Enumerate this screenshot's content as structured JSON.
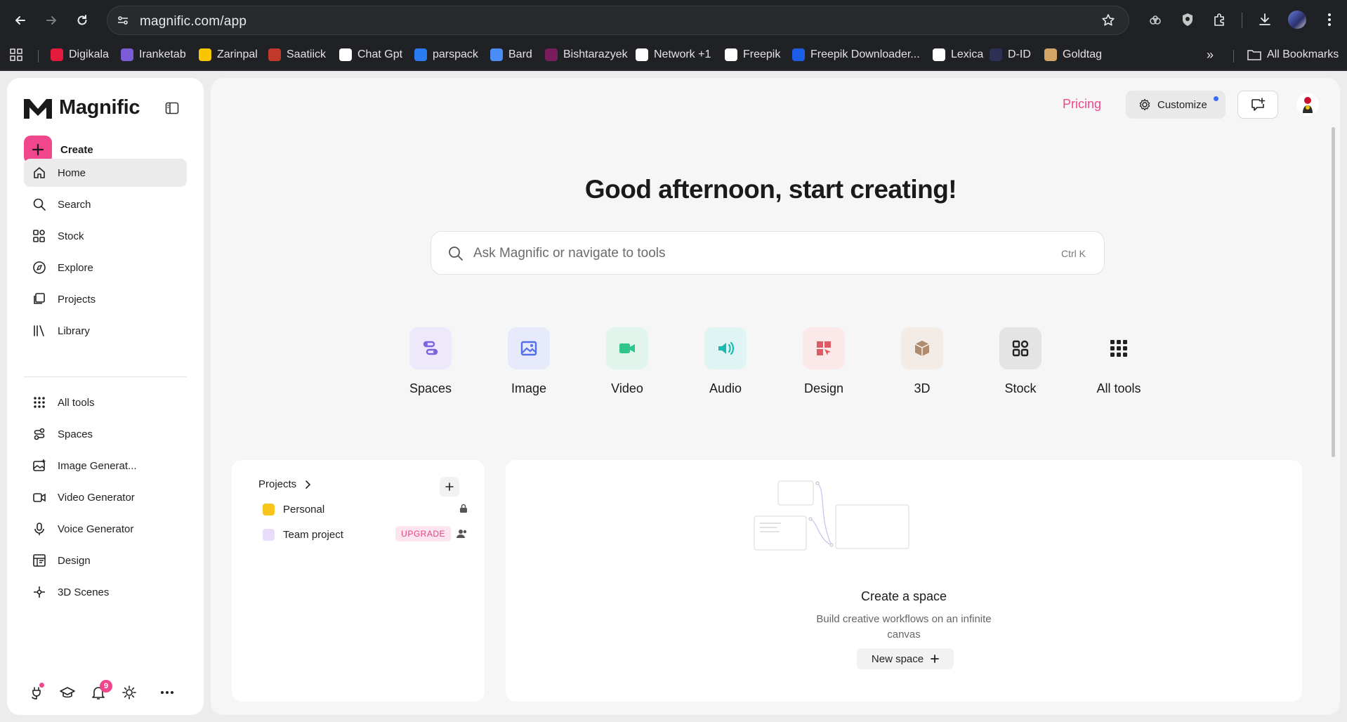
{
  "browser": {
    "url": "magnific.com/app",
    "bookmarks": [
      {
        "label": "Digikala",
        "color": "#e51b3e"
      },
      {
        "label": "Iranketab",
        "color": "#7b5cd6"
      },
      {
        "label": "Zarinpal",
        "color": "#f7c600"
      },
      {
        "label": "Saatiick",
        "color": "#c0392b"
      },
      {
        "label": "Chat Gpt",
        "color": "#ffffff"
      },
      {
        "label": "parspack",
        "color": "#2b7bf2"
      },
      {
        "label": "Bard",
        "color": "#4b8cf7"
      },
      {
        "label": "Bishtarazyek",
        "color": "#7a1d5c"
      },
      {
        "label": "Network +1",
        "color": "#ffffff"
      },
      {
        "label": "Freepik",
        "color": "#ffffff"
      },
      {
        "label": "Freepik Downloader...",
        "color": "#1c5ee8"
      },
      {
        "label": "Lexica",
        "color": "#ffffff"
      },
      {
        "label": "D-ID",
        "color": "#2d2f55"
      },
      {
        "label": "Goldtag",
        "color": "#d3a463"
      }
    ],
    "all_bookmarks": "All Bookmarks"
  },
  "sidebar": {
    "logo": "Magnific",
    "create": "Create",
    "primary": [
      {
        "label": "Home",
        "icon": "home-icon"
      },
      {
        "label": "Search",
        "icon": "search-icon"
      },
      {
        "label": "Stock",
        "icon": "stock-icon"
      },
      {
        "label": "Explore",
        "icon": "explore-icon"
      },
      {
        "label": "Projects",
        "icon": "projects-icon"
      },
      {
        "label": "Library",
        "icon": "library-icon"
      }
    ],
    "secondary": [
      {
        "label": "All tools",
        "icon": "grid-icon"
      },
      {
        "label": "Spaces",
        "icon": "spaces-icon"
      },
      {
        "label": "Image Generat...",
        "icon": "image-icon"
      },
      {
        "label": "Video Generator",
        "icon": "video-icon"
      },
      {
        "label": "Voice Generator",
        "icon": "mic-icon"
      },
      {
        "label": "Design",
        "icon": "design-icon"
      },
      {
        "label": "3D Scenes",
        "icon": "3d-icon"
      }
    ],
    "notification_count": "9"
  },
  "header": {
    "pricing": "Pricing",
    "customize": "Customize"
  },
  "main": {
    "greeting": "Good afternoon, start creating!",
    "search_placeholder": "Ask Magnific or navigate to tools",
    "search_shortcut": "Ctrl K",
    "tools": [
      {
        "label": "Spaces",
        "bg": "#ede9fb",
        "fg": "#7a63e0"
      },
      {
        "label": "Image",
        "bg": "#e6eafb",
        "fg": "#5570e6"
      },
      {
        "label": "Video",
        "bg": "#e1f5ec",
        "fg": "#2fc48a"
      },
      {
        "label": "Audio",
        "bg": "#dff5f4",
        "fg": "#1bb8b2"
      },
      {
        "label": "Design",
        "bg": "#fbe9ea",
        "fg": "#e05a66"
      },
      {
        "label": "3D",
        "bg": "#f3ece6",
        "fg": "#b08a6c"
      },
      {
        "label": "Stock",
        "bg": "#e4e4e4",
        "fg": "#222222"
      },
      {
        "label": "All tools",
        "bg": "#f6f6f6",
        "fg": "#222222"
      }
    ],
    "projects": {
      "title": "Projects",
      "items": [
        {
          "label": "Personal",
          "color": "#f9c51b"
        },
        {
          "label": "Team project",
          "color": "#e9dcfb",
          "badge": "UPGRADE"
        }
      ]
    },
    "space": {
      "title": "Create a space",
      "description": "Build creative workflows on an infinite canvas",
      "button": "New space"
    }
  }
}
